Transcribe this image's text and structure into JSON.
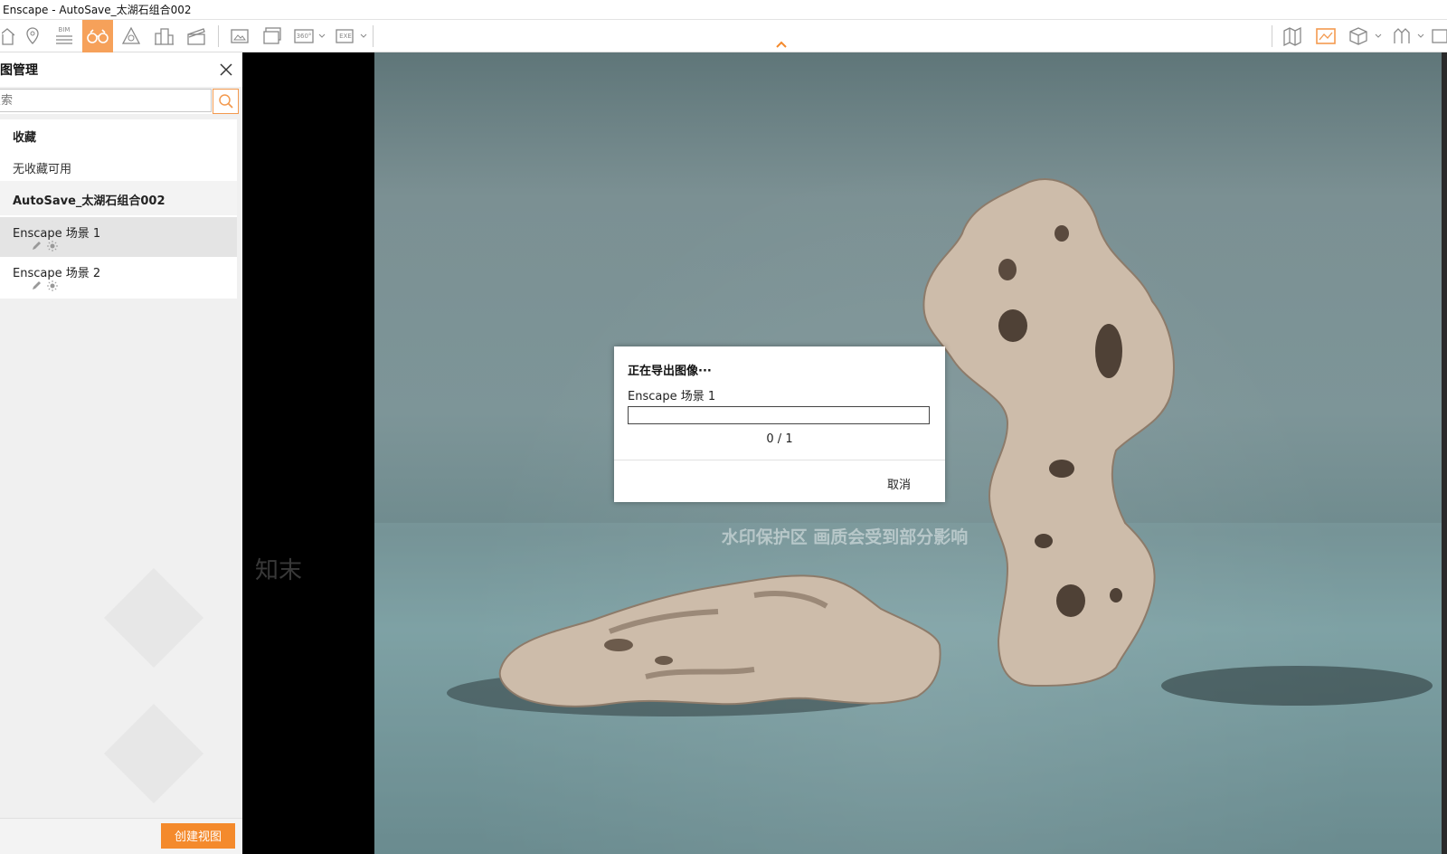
{
  "window": {
    "title": "Enscape - AutoSave_太湖石组合002"
  },
  "toolbar": {
    "accent_color": "#f6a15a",
    "left_icons": [
      "home-icon",
      "location-pin-icon",
      "bim-icon",
      "binoculars-icon",
      "perspective-icon",
      "buildings-icon",
      "clapperboard-icon",
      "image-export-icon",
      "batch-render-icon",
      "panorama-360-icon",
      "exe-export-icon"
    ],
    "bim_label": "BIM",
    "p360_label": "360°",
    "exe_label": "EXE",
    "right_icons": [
      "map-icon",
      "render-view-icon",
      "cube-icon",
      "assets-icon",
      "settings-icon"
    ],
    "active": "binoculars-icon"
  },
  "panel": {
    "title": "视图管理",
    "search_placeholder": "搜索",
    "favorites_title": "收藏",
    "favorites_empty": "无收藏可用",
    "project_title": "AutoSave_太湖石组合002",
    "views": [
      {
        "label": "Enscape 场景 1",
        "selected": true
      },
      {
        "label": "Enscape 场景 2",
        "selected": false
      }
    ],
    "create_button": "创建视图"
  },
  "watermark": {
    "notice": "水印保护区   画质会受到部分影响",
    "brand": "知末"
  },
  "dialog": {
    "title": "正在导出图像···",
    "scene_name": "Enscape 场景 1",
    "progress": 0,
    "count_text": "0 / 1",
    "cancel_label": "取消"
  },
  "colors": {
    "brand_orange": "#f48a2c",
    "scene_bg": "#7d9598"
  }
}
